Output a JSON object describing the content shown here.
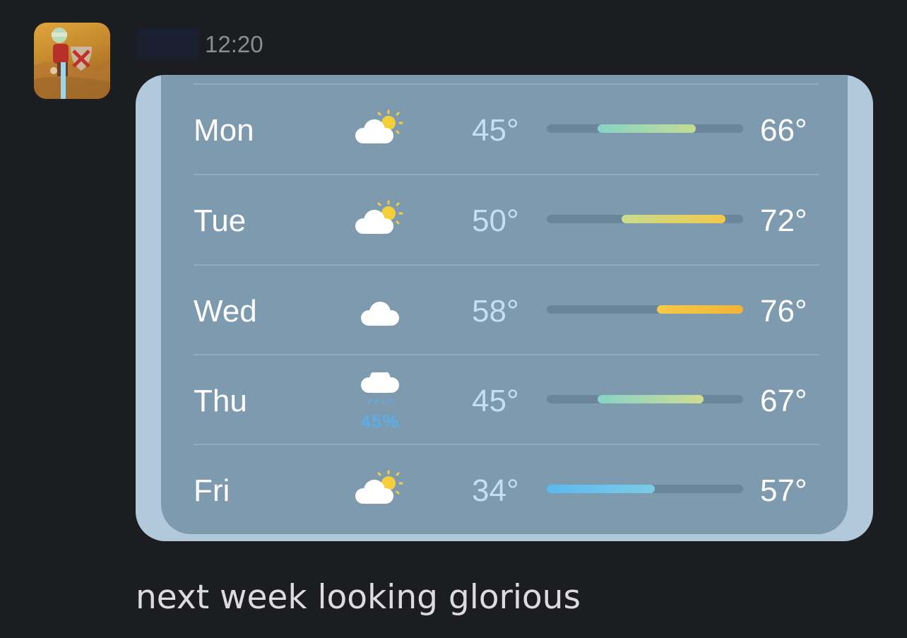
{
  "message": {
    "time": "12:20",
    "text": "next week looking glorious"
  },
  "forecast": [
    {
      "day": "Mon",
      "icon": "partly-sunny-icon",
      "low": "45°",
      "high": "66°",
      "bar_start": 0.26,
      "bar_end": 0.76,
      "bar_colors": [
        "#86d3c6",
        "#c3dc92"
      ]
    },
    {
      "day": "Tue",
      "icon": "partly-sunny-icon",
      "low": "50°",
      "high": "72°",
      "bar_start": 0.38,
      "bar_end": 0.91,
      "bar_colors": [
        "#c7dc8e",
        "#f2c84a"
      ]
    },
    {
      "day": "Wed",
      "icon": "cloud-icon",
      "low": "58°",
      "high": "76°",
      "bar_start": 0.56,
      "bar_end": 1.0,
      "bar_colors": [
        "#f5c948",
        "#f0b43a"
      ]
    },
    {
      "day": "Thu",
      "icon": "rain-cloud-icon",
      "precip": "45%",
      "low": "45°",
      "high": "67°",
      "bar_start": 0.26,
      "bar_end": 0.8,
      "bar_colors": [
        "#86d3c6",
        "#d0dc90"
      ]
    },
    {
      "day": "Fri",
      "icon": "partly-sunny-icon",
      "low": "34°",
      "high": "57°",
      "bar_start": 0.0,
      "bar_end": 0.55,
      "bar_colors": [
        "#5ab9ee",
        "#7ccbe6"
      ]
    }
  ]
}
